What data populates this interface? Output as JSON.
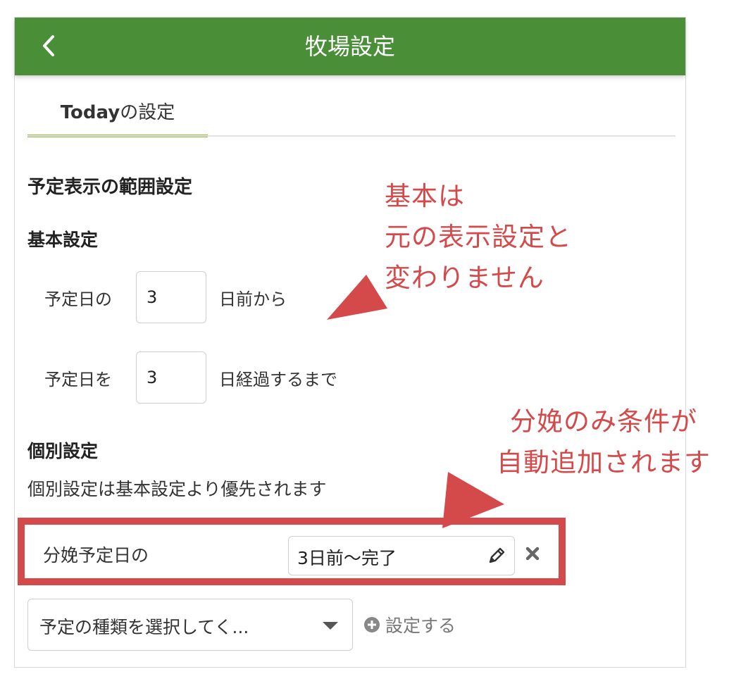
{
  "header": {
    "title": "牧場設定"
  },
  "tabs": [
    {
      "label_bold": "Today",
      "label_rest": "の設定"
    }
  ],
  "display_range": {
    "title": "予定表示の範囲設定",
    "basic": {
      "title": "基本設定",
      "before_label": "予定日の",
      "before_value": "3",
      "before_suffix": "日前から",
      "after_label": "予定日を",
      "after_value": "3",
      "after_suffix": "日経過するまで"
    },
    "individual": {
      "title": "個別設定",
      "description": "個別設定は基本設定より優先されます",
      "rows": [
        {
          "label": "分娩予定日の",
          "value": "3日前〜完了"
        }
      ],
      "select_placeholder": "予定の種類を選択してく...",
      "add_label": "設定する"
    }
  },
  "annotations": {
    "note1": [
      "基本は",
      "元の表示設定と",
      "変わりません"
    ],
    "note2": [
      "分娩のみ条件が",
      "自動追加されます"
    ]
  },
  "colors": {
    "header_bg": "#4a8f38",
    "tab_underline": "#8fbf3a",
    "annotation": "#d44a4a"
  },
  "icons": {
    "back": "chevron-left-icon",
    "edit": "pencil-icon",
    "remove": "close-icon",
    "add": "plus-circle-icon",
    "dropdown": "caret-down-icon"
  }
}
